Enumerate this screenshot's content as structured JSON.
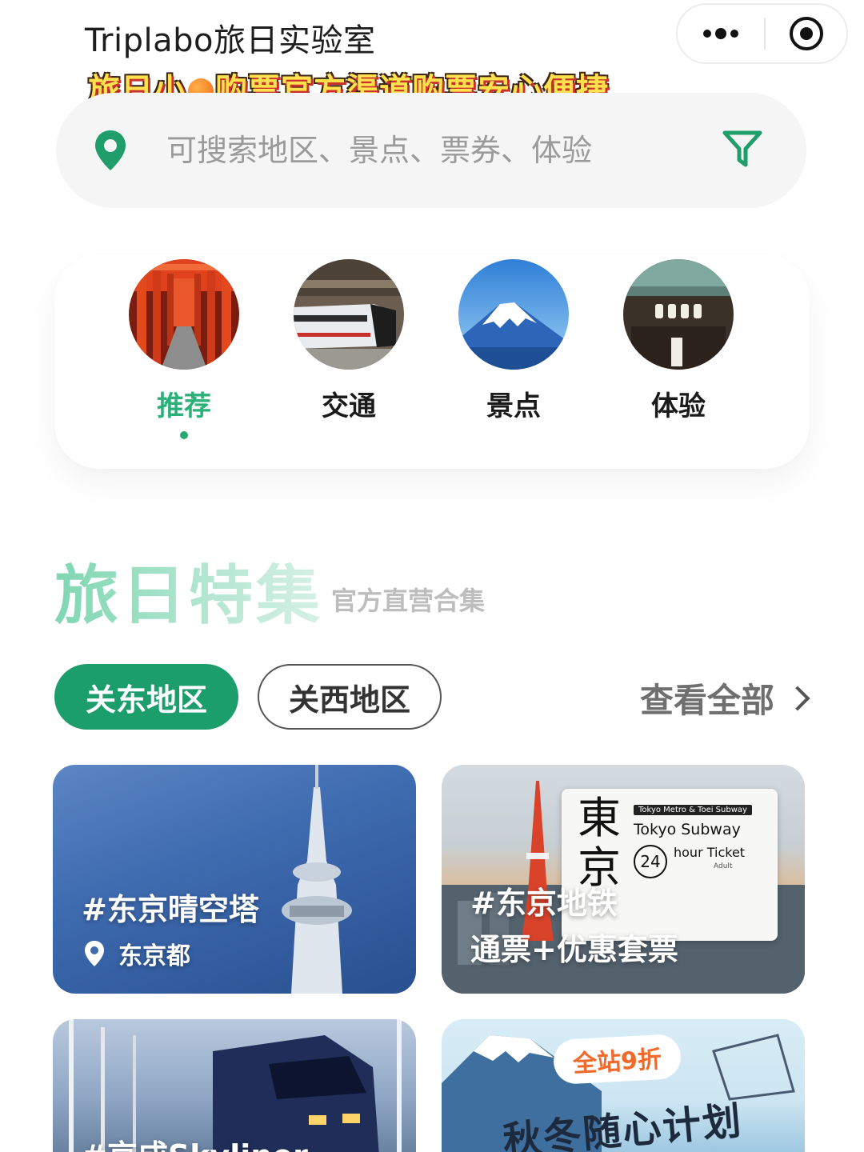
{
  "header": {
    "app_title": "Triplabo旅日实验室",
    "promo": {
      "before_icon": "旅日小",
      "icon": "orange-icon",
      "after_icon": "购票官方渠道购票安心便捷"
    }
  },
  "search": {
    "placeholder": "可搜索地区、景点、票券、体验"
  },
  "categories": [
    {
      "label": "推荐",
      "icon": "torii-gates-image",
      "active": true
    },
    {
      "label": "交通",
      "icon": "train-image",
      "active": false
    },
    {
      "label": "景点",
      "icon": "mount-fuji-image",
      "active": false
    },
    {
      "label": "体验",
      "icon": "temple-image",
      "active": false
    }
  ],
  "section": {
    "title": "旅日特集",
    "subtitle": "官方直营合集"
  },
  "region_tabs": [
    {
      "label": "关东地区",
      "active": true
    },
    {
      "label": "关西地区",
      "active": false
    }
  ],
  "view_all_label": "查看全部",
  "cards": [
    {
      "title": "#东京晴空塔",
      "location": "东京都"
    },
    {
      "title_line1": "#东京地铁",
      "title_line2": "通票+优惠套票",
      "ticket": {
        "kanji": "東京",
        "brand": "Tokyo Metro & Toei Subway",
        "name": "Tokyo Subway",
        "hours": "24",
        "type": "hour Ticket",
        "adult": "Adult"
      }
    },
    {
      "title": "#京成Skyliner"
    },
    {
      "badge": "全站9折",
      "slogan": "秋冬随心计划"
    }
  ],
  "colors": {
    "brand_green": "#1b9e6c",
    "accent_green": "#2bb07a",
    "search_bg": "#f5f5f5"
  }
}
